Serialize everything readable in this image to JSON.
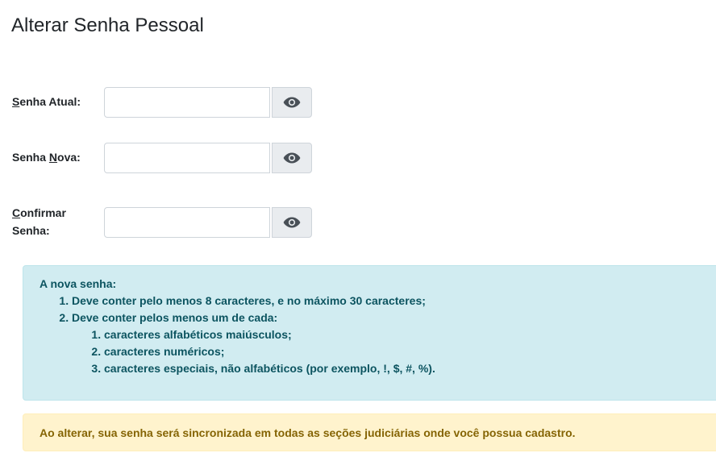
{
  "page": {
    "title": "Alterar Senha Pessoal"
  },
  "form": {
    "current_password": {
      "label_key": "S",
      "label_rest": "enha Atual:",
      "value": ""
    },
    "new_password": {
      "label_pre": "Senha ",
      "label_key": "N",
      "label_rest": "ova:",
      "value": ""
    },
    "confirm_password": {
      "label_key": "C",
      "label_line1_rest": "onfirmar",
      "label_line2": "Senha:",
      "value": ""
    },
    "toggle_icon": "eye-icon"
  },
  "info": {
    "intro": "A nova senha:",
    "rule1": "Deve conter pelo menos 8 caracteres, e no máximo 30 caracteres;",
    "rule2": "Deve conter pelos menos um de cada:",
    "subrules": [
      "caracteres alfabéticos maiúsculos;",
      "caracteres numéricos;",
      "caracteres especiais, não alfabéticos (por exemplo, !, $, #, %)."
    ]
  },
  "warning": {
    "text": "Ao alterar, sua senha será sincronizada em todas as seções judiciárias onde você possua cadastro."
  },
  "colors": {
    "info_bg": "#d1ecf1",
    "info_text": "#0c5460",
    "warning_bg": "#fff3cd",
    "warning_text": "#856404",
    "button_bg": "#e9ecef",
    "icon": "#495057"
  }
}
